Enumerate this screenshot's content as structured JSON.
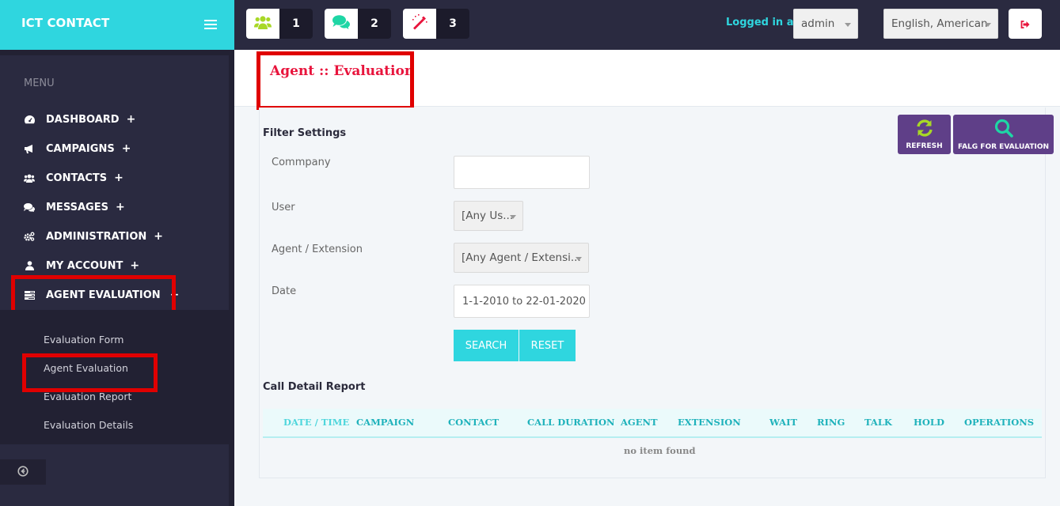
{
  "brand": {
    "name": "ICT CONTACT"
  },
  "sidebar": {
    "menu_label": "MENU",
    "items": [
      {
        "label": "DASHBOARD",
        "icon": "dashboard-icon",
        "toggle": "+"
      },
      {
        "label": "CAMPAIGNS",
        "icon": "bullhorn-icon",
        "toggle": "+"
      },
      {
        "label": "CONTACTS",
        "icon": "users-icon",
        "toggle": "+"
      },
      {
        "label": "MESSAGES",
        "icon": "comments-icon",
        "toggle": "+"
      },
      {
        "label": "ADMINISTRATION",
        "icon": "cogs-icon",
        "toggle": "+"
      },
      {
        "label": "MY ACCOUNT",
        "icon": "user-icon",
        "toggle": "+"
      },
      {
        "label": "AGENT EVALUATION",
        "icon": "tasks-icon",
        "toggle": "−"
      }
    ],
    "sub_items": [
      {
        "label": "Evaluation Form"
      },
      {
        "label": "Agent Evaluation"
      },
      {
        "label": "Evaluation Report"
      },
      {
        "label": "Evaluation Details"
      }
    ]
  },
  "topbar": {
    "badges": [
      {
        "icon": "users-icon",
        "count": "1",
        "color": "#a8d826"
      },
      {
        "icon": "comments-icon",
        "count": "2",
        "color": "#1ed6a5"
      },
      {
        "icon": "magic-wand-icon",
        "count": "3",
        "color": "#e8143c"
      }
    ],
    "logged_in_label": "Logged in as :",
    "user_select": "admin",
    "language_select": "English, American"
  },
  "page": {
    "title": "Agent :: Evaluation"
  },
  "filter": {
    "title": "Filter Settings",
    "company_label": "Commpany",
    "company_value": "",
    "user_label": "User",
    "user_value": "[Any Us...",
    "agent_label": "Agent / Extension",
    "agent_value": "[Any Agent / Extensi...",
    "date_label": "Date",
    "date_value": "1-1-2010 to 22-01-2020",
    "search_label": "SEARCH",
    "reset_label": "RESET"
  },
  "actions": {
    "refresh_label": "REFRESH",
    "flag_label": "FALG FOR EVALUATION"
  },
  "report": {
    "title": "Call Detail Report",
    "columns": [
      "DATE / TIME",
      "CAMPAIGN",
      "CONTACT",
      "CALL DURATION",
      "AGENT",
      "EXTENSION",
      "WAIT",
      "RING",
      "TALK",
      "HOLD",
      "OPERATIONS"
    ],
    "empty_text": "no item found"
  },
  "colors": {
    "brand": "#2fd6df",
    "sidebar_bg": "#222133",
    "title_red": "#e8143c",
    "action_purple": "#5f3f88",
    "highlight": "#e00000"
  }
}
